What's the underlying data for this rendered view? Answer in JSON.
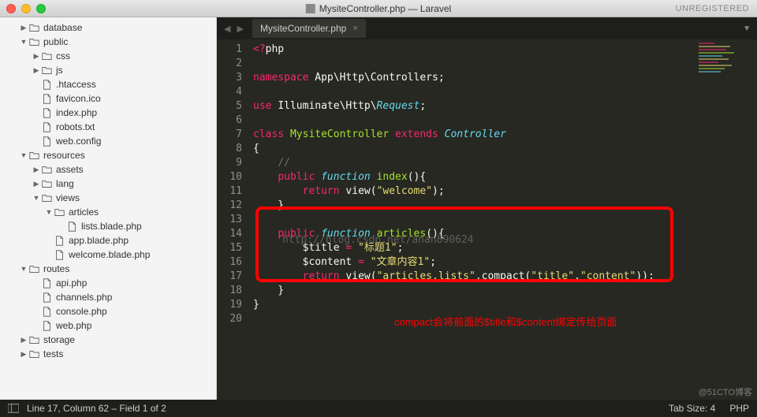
{
  "titlebar": {
    "filename": "MysiteController.php — Laravel",
    "unregistered": "UNREGISTERED"
  },
  "sidebar": {
    "items": [
      {
        "depth": 1,
        "arrow": "▶",
        "type": "folder",
        "label": "database"
      },
      {
        "depth": 1,
        "arrow": "▼",
        "type": "folder",
        "label": "public"
      },
      {
        "depth": 2,
        "arrow": "▶",
        "type": "folder",
        "label": "css"
      },
      {
        "depth": 2,
        "arrow": "▶",
        "type": "folder",
        "label": "js"
      },
      {
        "depth": 2,
        "arrow": "",
        "type": "file",
        "label": ".htaccess"
      },
      {
        "depth": 2,
        "arrow": "",
        "type": "file",
        "label": "favicon.ico"
      },
      {
        "depth": 2,
        "arrow": "",
        "type": "file",
        "label": "index.php"
      },
      {
        "depth": 2,
        "arrow": "",
        "type": "file",
        "label": "robots.txt"
      },
      {
        "depth": 2,
        "arrow": "",
        "type": "file",
        "label": "web.config"
      },
      {
        "depth": 1,
        "arrow": "▼",
        "type": "folder",
        "label": "resources"
      },
      {
        "depth": 2,
        "arrow": "▶",
        "type": "folder",
        "label": "assets"
      },
      {
        "depth": 2,
        "arrow": "▶",
        "type": "folder",
        "label": "lang"
      },
      {
        "depth": 2,
        "arrow": "▼",
        "type": "folder",
        "label": "views"
      },
      {
        "depth": 3,
        "arrow": "▼",
        "type": "folder",
        "label": "articles"
      },
      {
        "depth": 4,
        "arrow": "",
        "type": "file",
        "label": "lists.blade.php"
      },
      {
        "depth": 3,
        "arrow": "",
        "type": "file",
        "label": "app.blade.php"
      },
      {
        "depth": 3,
        "arrow": "",
        "type": "file",
        "label": "welcome.blade.php"
      },
      {
        "depth": 1,
        "arrow": "▼",
        "type": "folder",
        "label": "routes"
      },
      {
        "depth": 2,
        "arrow": "",
        "type": "file",
        "label": "api.php"
      },
      {
        "depth": 2,
        "arrow": "",
        "type": "file",
        "label": "channels.php"
      },
      {
        "depth": 2,
        "arrow": "",
        "type": "file",
        "label": "console.php"
      },
      {
        "depth": 2,
        "arrow": "",
        "type": "file",
        "label": "web.php"
      },
      {
        "depth": 1,
        "arrow": "▶",
        "type": "folder",
        "label": "storage"
      },
      {
        "depth": 1,
        "arrow": "▶",
        "type": "folder",
        "label": "tests"
      }
    ]
  },
  "tab": {
    "label": "MysiteController.php",
    "close": "×"
  },
  "code": {
    "lines": [
      {
        "n": "1",
        "html": "<span class='op'>&lt;?</span><span class='var'>php</span>"
      },
      {
        "n": "2",
        "html": ""
      },
      {
        "n": "3",
        "html": "<span class='kw'>namespace</span> <span class='var'>App\\Http\\Controllers</span>;"
      },
      {
        "n": "4",
        "html": ""
      },
      {
        "n": "5",
        "html": "<span class='kw'>use</span> <span class='var'>Illuminate\\Http\\</span><span class='fn'>Request</span>;"
      },
      {
        "n": "6",
        "html": ""
      },
      {
        "n": "7",
        "html": "<span class='kw'>class</span> <span class='cls'>MysiteController</span> <span class='kw'>extends</span> <span class='fn'>Controller</span>"
      },
      {
        "n": "8",
        "html": "{"
      },
      {
        "n": "9",
        "html": "    <span class='cm'>//</span>"
      },
      {
        "n": "10",
        "html": "    <span class='kw'>public</span> <span class='fn'>function</span> <span class='cls'>index</span>(){"
      },
      {
        "n": "11",
        "html": "        <span class='kw'>return</span> <span class='var'>view</span>(<span class='str'>\"welcome\"</span>);"
      },
      {
        "n": "12",
        "html": "    }"
      },
      {
        "n": "13",
        "html": ""
      },
      {
        "n": "14",
        "html": "    <span class='kw'>public</span> <span class='fn'>function</span> <span class='cls'>articles</span>(){"
      },
      {
        "n": "15",
        "html": "        <span class='var'>$title</span> <span class='op'>=</span> <span class='str'>\"标题1\"</span>;"
      },
      {
        "n": "16",
        "html": "        <span class='var'>$content</span> <span class='op'>=</span> <span class='str'>\"文章内容1\"</span>;"
      },
      {
        "n": "17",
        "html": "        <span class='kw'>return</span> <span class='var'>view</span>(<span class='str'>\"articles.lists\"</span>,<span class='var'>compact</span>(<span class='str'>\"title\"</span>,<span class='str'>\"content\"</span>));"
      },
      {
        "n": "18",
        "html": "    }"
      },
      {
        "n": "19",
        "html": "}"
      },
      {
        "n": "20",
        "html": ""
      }
    ]
  },
  "annotation": "compact会将前面的$title和$content绑定传给页面",
  "watermark": "http://blog.csdn.net/anan890624",
  "corner_watermark": "@51CTO博客",
  "status": {
    "pos": "Line 17, Column 62 – Field 1 of 2",
    "tabsize": "Tab Size: 4",
    "lang": "PHP"
  }
}
